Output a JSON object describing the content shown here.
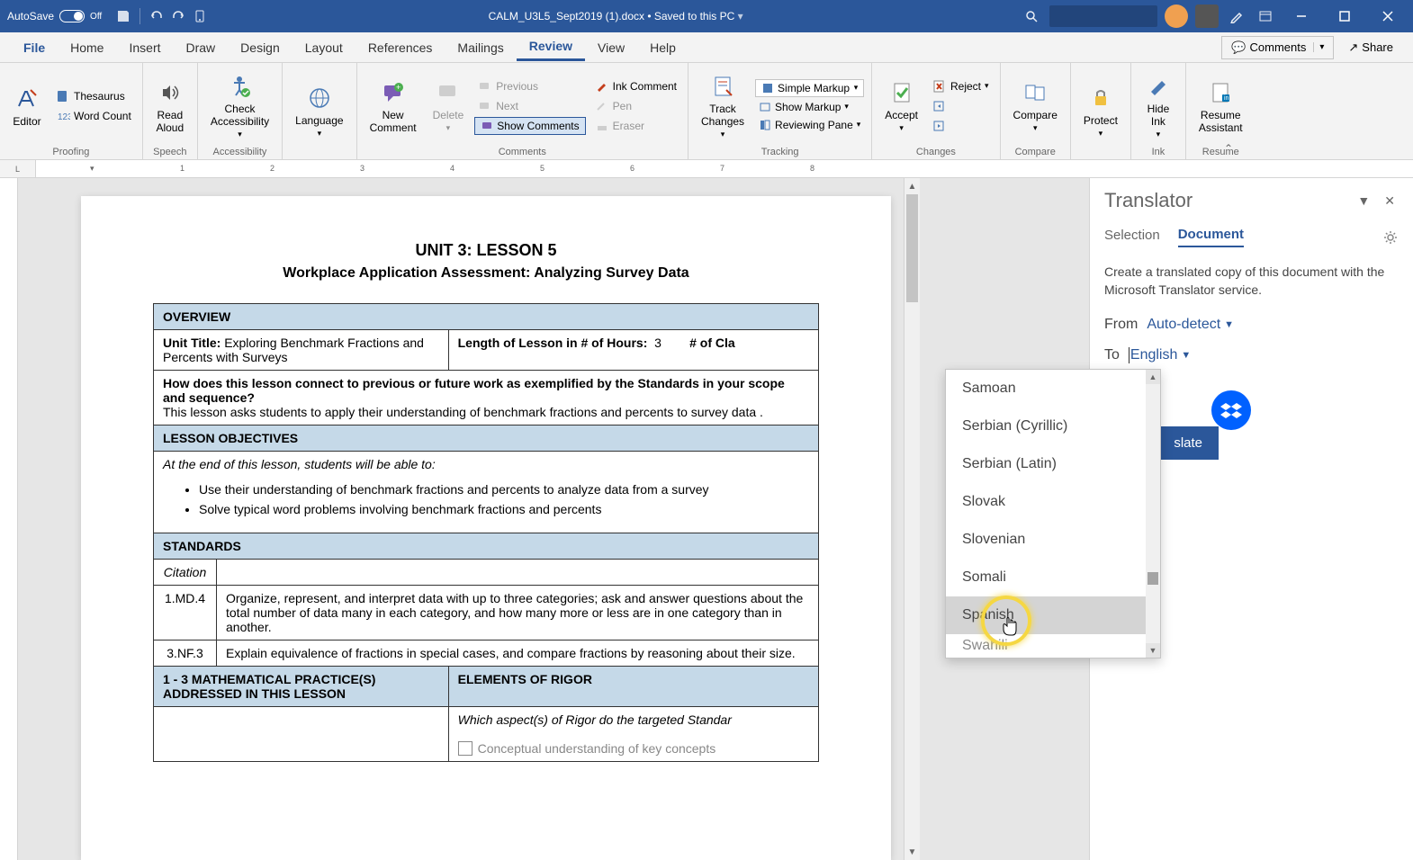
{
  "titlebar": {
    "autosave_label": "AutoSave",
    "autosave_state": "Off",
    "doc_title": "CALM_U3L5_Sept2019 (1).docx • Saved to this PC"
  },
  "tabs": {
    "file": "File",
    "home": "Home",
    "insert": "Insert",
    "draw": "Draw",
    "design": "Design",
    "layout": "Layout",
    "references": "References",
    "mailings": "Mailings",
    "review": "Review",
    "view": "View",
    "help": "Help",
    "comments": "Comments",
    "share": "Share"
  },
  "ribbon": {
    "editor": "Editor",
    "thesaurus": "Thesaurus",
    "word_count": "Word Count",
    "proofing": "Proofing",
    "read_aloud": "Read\nAloud",
    "speech": "Speech",
    "check_accessibility": "Check\nAccessibility",
    "accessibility": "Accessibility",
    "language": "Language",
    "new_comment": "New\nComment",
    "delete": "Delete",
    "previous": "Previous",
    "next": "Next",
    "show_comments": "Show Comments",
    "ink_comment": "Ink Comment",
    "pen": "Pen",
    "eraser": "Eraser",
    "comments": "Comments",
    "track_changes": "Track\nChanges",
    "simple_markup": "Simple Markup",
    "show_markup": "Show Markup",
    "reviewing_pane": "Reviewing Pane",
    "tracking": "Tracking",
    "accept": "Accept",
    "reject": "Reject",
    "changes": "Changes",
    "compare": "Compare",
    "protect": "Protect",
    "hide_ink": "Hide\nInk",
    "ink": "Ink",
    "resume_assistant": "Resume\nAssistant",
    "resume": "Resume"
  },
  "ruler": [
    "1",
    "2",
    "3",
    "4",
    "5",
    "6",
    "7",
    "8"
  ],
  "document": {
    "title": "UNIT 3: LESSON 5",
    "subtitle": "Workplace Application Assessment: Analyzing Survey Data",
    "overview_hdr": "OVERVIEW",
    "unit_title_label": "Unit Title:",
    "unit_title_val": "Exploring Benchmark Fractions and Percents with Surveys",
    "length_label": "Length of Lesson in # of Hours:",
    "length_val": "3",
    "num_cla": "# of Cla",
    "connect_q": "How does this lesson connect to previous or future work as exemplified by the Standards in your scope and sequence?",
    "connect_a": "This lesson asks students to apply their understanding of benchmark fractions and percents to survey data .",
    "objectives_hdr": "LESSON OBJECTIVES",
    "objectives_intro": "At the end of this lesson, students will be able to:",
    "obj1": "Use their understanding of benchmark fractions and percents to analyze data from a survey",
    "obj2": "Solve typical word problems involving benchmark fractions and percents",
    "standards_hdr": "STANDARDS",
    "citation": "Citation",
    "std1_code": "1.MD.4",
    "std1_text": "Organize, represent, and interpret data with up to three categories; ask and answer questions about the total number of data many in each category, and how many more or less are in one category than in another.",
    "std2_code": "3.NF.3",
    "std2_text": "Explain equivalence of fractions in special cases, and compare fractions by reasoning about their size.",
    "practice_hdr": "1 - 3 MATHEMATICAL PRACTICE(S) ADDRESSED IN THIS LESSON",
    "rigor_hdr": "ELEMENTS OF RIGOR",
    "rigor_q": "Which aspect(s) of Rigor do the targeted Standar",
    "rigor_chk": "Conceptual understanding of key concepts"
  },
  "translator": {
    "title": "Translator",
    "tab_selection": "Selection",
    "tab_document": "Document",
    "description": "Create a translated copy of this document with the Microsoft Translator service.",
    "from_label": "From",
    "from_value": "Auto-detect",
    "to_label": "To",
    "to_value": "English",
    "translate_btn": "slate",
    "languages": [
      "Samoan",
      "Serbian (Cyrillic)",
      "Serbian (Latin)",
      "Slovak",
      "Slovenian",
      "Somali",
      "Spanish",
      "Swahili"
    ]
  }
}
